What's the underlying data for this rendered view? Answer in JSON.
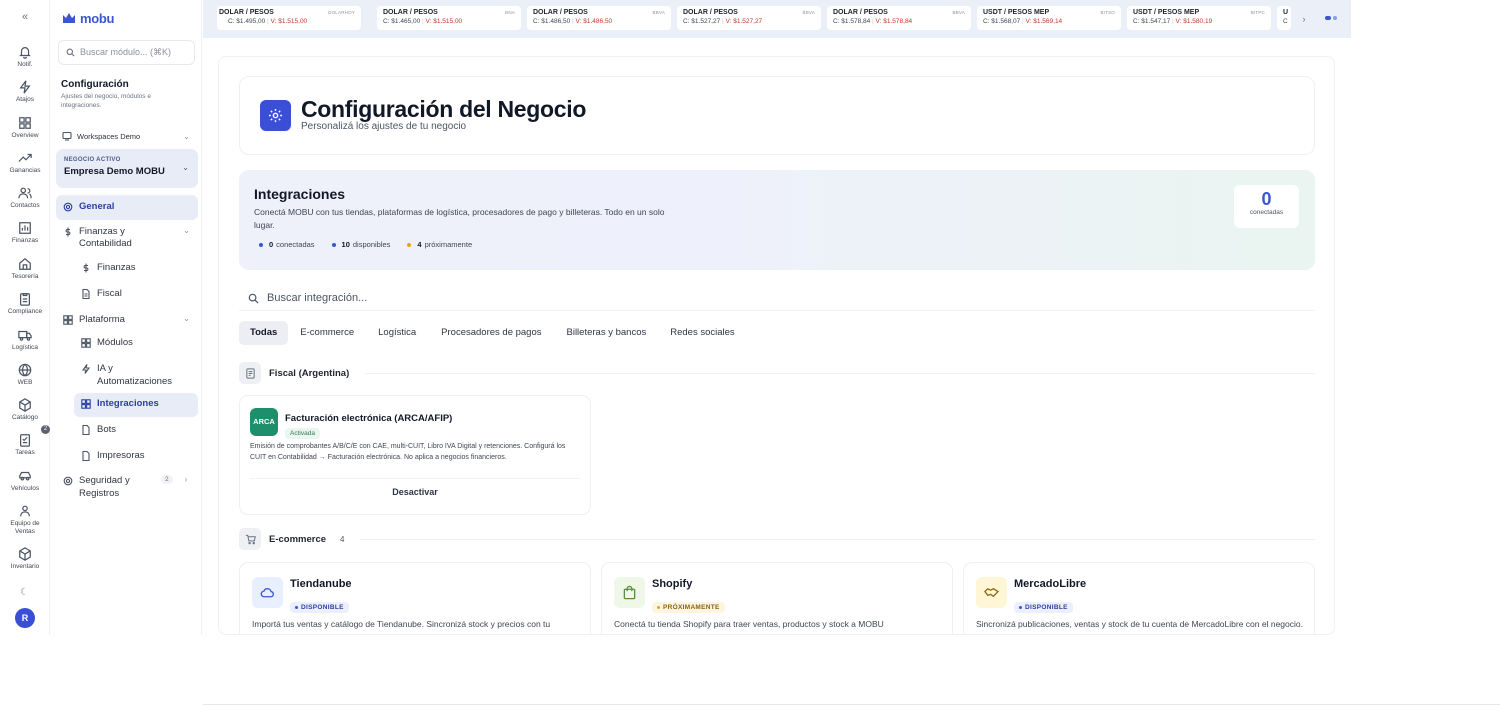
{
  "rail": {
    "items": [
      {
        "label": "Notif.",
        "icon": "bell-icon"
      },
      {
        "label": "Atajos",
        "icon": "lightning-icon"
      },
      {
        "label": "Overview",
        "icon": "grid-icon"
      },
      {
        "label": "Ganancias",
        "icon": "trend-up-icon"
      },
      {
        "label": "Contactos",
        "icon": "users-icon"
      },
      {
        "label": "Finanzas",
        "icon": "bar-chart-icon"
      },
      {
        "label": "Tesorería",
        "icon": "home-icon"
      },
      {
        "label": "Compliance",
        "icon": "clipboard-icon"
      },
      {
        "label": "Logística",
        "icon": "truck-icon"
      },
      {
        "label": "WEB",
        "icon": "globe-icon"
      },
      {
        "label": "Catálogo",
        "icon": "box-icon"
      },
      {
        "label": "Tareas",
        "icon": "checklist-icon"
      },
      {
        "label": "Vehículos",
        "icon": "car-icon"
      },
      {
        "label": "Equipo de Ventas",
        "icon": "team-icon"
      },
      {
        "label": "Inventario",
        "icon": "cube-icon"
      }
    ],
    "catalog_badge": "2",
    "avatar_initial": "R",
    "theme_icon": "moon-icon"
  },
  "sidebar": {
    "logo_text": "mobu",
    "search_placeholder": "Buscar módulo... (⌘K)",
    "section_title": "Configuración",
    "section_desc": "Ajustes del negocio, módulos e integraciones.",
    "workspace": "Workspaces Demo",
    "business_caption": "NEGOCIO ACTIVO",
    "business_name": "Empresa Demo MOBU",
    "nav": {
      "general": "General",
      "finanzas_group": "Finanzas y Contabilidad",
      "finanzas": "Finanzas",
      "fiscal": "Fiscal",
      "plataforma_group": "Plataforma",
      "modulos": "Módulos",
      "ia": "IA y Automatizaciones",
      "integraciones": "Integraciones",
      "bots": "Bots",
      "impresoras": "Impresoras",
      "seguridad_group": "Seguridad y Registros",
      "seguridad_count": "2"
    }
  },
  "ticker": {
    "cards": [
      {
        "pair": "DOLAR / PESOS",
        "source": "DOLARHOY",
        "buy": "C: $1.495,00",
        "sell": "V: $1.515,00"
      },
      {
        "pair": "DOLAR / PESOS",
        "source": "BNA",
        "buy": "C: $1.465,00",
        "sell": "V: $1.515,00"
      },
      {
        "pair": "DOLAR / PESOS",
        "source": "BBVA",
        "buy": "C: $1.486,50",
        "sell": "V: $1.486,50"
      },
      {
        "pair": "DOLAR / PESOS",
        "source": "BBVA",
        "buy": "C: $1.527,27",
        "sell": "V: $1.527,27"
      },
      {
        "pair": "DOLAR / PESOS",
        "source": "BBVA",
        "buy": "C: $1.578,84",
        "sell": "V: $1.578,84"
      },
      {
        "pair": "USDT / PESOS MEP",
        "source": "BITSO",
        "buy": "C: $1.568,07",
        "sell": "V: $1.569,14"
      },
      {
        "pair": "USDT / PESOS MEP",
        "source": "BITPC",
        "buy": "C: $1.547,17",
        "sell": "V: $1.580,19"
      },
      {
        "pair": "U",
        "source": "",
        "buy": "C",
        "sell": ""
      }
    ]
  },
  "header": {
    "title": "Configuración del Negocio",
    "subtitle": "Personalizá los ajustes de tu negocio",
    "icon": "gear-icon"
  },
  "hero": {
    "title": "Integraciones",
    "desc": "Conectá MOBU con tus tiendas, plataformas de logística, procesadores de pago y billeteras. Todo en un solo lugar.",
    "stats": [
      {
        "value": "0",
        "label": "conectadas",
        "color": "#3a56d4"
      },
      {
        "value": "10",
        "label": "disponibles",
        "color": "#3a56d4"
      },
      {
        "value": "4",
        "label": "próximamente",
        "color": "#e0a425"
      }
    ],
    "kpi_value": "0",
    "kpi_label": "conectadas"
  },
  "search": {
    "placeholder": "Buscar integración..."
  },
  "tabs": [
    "Todas",
    "E-commerce",
    "Logística",
    "Procesadores de pagos",
    "Billeteras y bancos",
    "Redes sociales"
  ],
  "groups": {
    "fiscal": {
      "title": "Fiscal (Argentina)"
    },
    "ecommerce": {
      "title": "E-commerce",
      "count": "4"
    }
  },
  "fiscal_card": {
    "logo": "ARCA",
    "name": "Facturación electrónica (ARCA/AFIP)",
    "status": "Activada",
    "desc": "Emisión de comprobantes A/B/C/E con CAE, multi-CUIT, Libro IVA Digital y retenciones. Configurá los CUIT en Contabilidad → Facturación electrónica. No aplica a negocios financieros.",
    "button": "Desactivar"
  },
  "ecommerce_cards": [
    {
      "name": "Tiendanube",
      "status": "DISPONIBLE",
      "desc": "Importá tus ventas y catálogo de Tiendanube. Sincronizá stock y precios con tu negocio en tiempo real.",
      "icon": "cloud-icon",
      "color": "#e8f0ff"
    },
    {
      "name": "Shopify",
      "status": "PRÓXIMAMENTE",
      "desc": "Conectá tu tienda Shopify para traer ventas, productos y stock a MOBU automáticamente.",
      "icon": "shopping-bag-icon",
      "color": "#eef7e8"
    },
    {
      "name": "MercadoLibre",
      "status": "DISPONIBLE",
      "desc": "Sincronizá publicaciones, ventas y stock de tu cuenta de MercadoLibre con el negocio.",
      "icon": "handshake-icon",
      "color": "#fff6d6"
    }
  ]
}
